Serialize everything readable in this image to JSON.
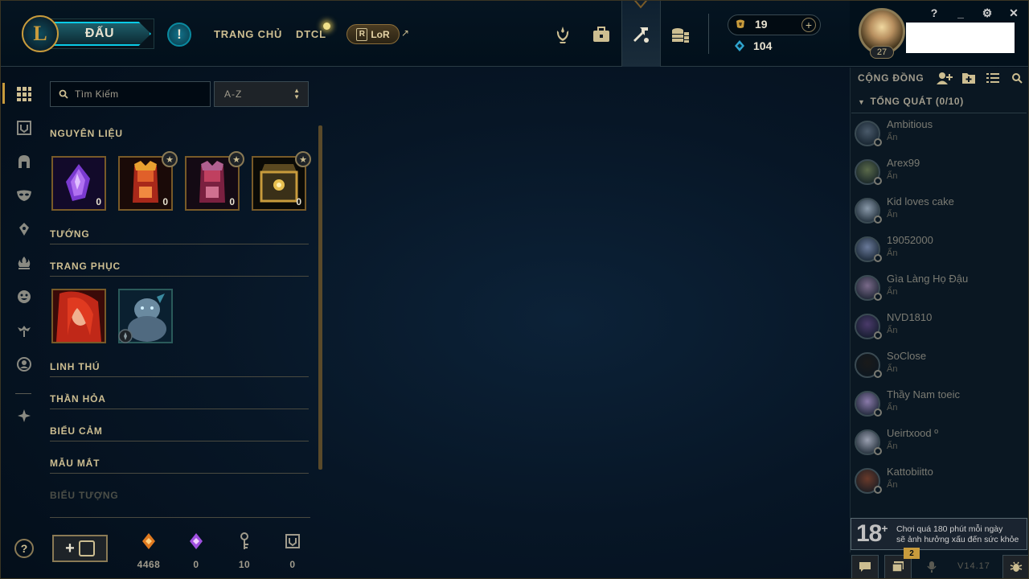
{
  "topbar": {
    "play_label": "ĐẤU",
    "nav_home": "TRANG CHỦ",
    "nav_tft": "DTCL",
    "nav_lor": "LoR",
    "nav_lor_mark": "R",
    "ext_arrow": "↗",
    "alert_glyph": "!"
  },
  "currency": {
    "rp": "19",
    "be": "104"
  },
  "profile": {
    "level": "27"
  },
  "window_controls": {
    "help": "?",
    "minimize": "_",
    "settings": "⚙",
    "close": "✕"
  },
  "collection": {
    "search_placeholder": "Tìm Kiếm",
    "sort_value": "A-Z",
    "sections": {
      "materials": "NGUYÊN LIỆU",
      "champions": "TƯỚNG",
      "skins": "TRANG PHỤC",
      "pets": "LINH THÚ",
      "totems": "THẦN HỎA",
      "emotes": "BIỂU CẢM",
      "ward_skins": "MẪU MẮT",
      "icons": "BIỂU TƯỢNG"
    },
    "materials": [
      {
        "name": "mythic-essence",
        "count": "0",
        "star": false
      },
      {
        "name": "red-chest",
        "count": "0",
        "star": true
      },
      {
        "name": "purple-chest",
        "count": "0",
        "star": true
      },
      {
        "name": "hextech-chest",
        "count": "0",
        "star": true
      }
    ],
    "star_glyph": "★"
  },
  "resources": [
    {
      "name": "orange-essence",
      "value": "4468"
    },
    {
      "name": "mythic-essence",
      "value": "0"
    },
    {
      "name": "key",
      "value": "10"
    },
    {
      "name": "chest",
      "value": "0"
    }
  ],
  "craft_button": {
    "plus": "+"
  },
  "help_button": "?",
  "social": {
    "header": "CỘNG ĐỒNG",
    "group": "TỔNG QUÁT (0/10)",
    "friends": [
      {
        "name": "Ambitious",
        "status": "Ẩn",
        "color": "#4a5a6a"
      },
      {
        "name": "Arex99",
        "status": "Ẩn",
        "color": "#5a6a4a"
      },
      {
        "name": "Kid loves cake",
        "status": "Ẩn",
        "color": "#8a9aaa"
      },
      {
        "name": "19052000",
        "status": "Ẩn",
        "color": "#6a7a9a"
      },
      {
        "name": "Gìa Làng Họ Đậu",
        "status": "Ẩn",
        "color": "#7a6a8a"
      },
      {
        "name": "NVD1810",
        "status": "Ẩn",
        "color": "#4a3a6a"
      },
      {
        "name": "SoClose",
        "status": "Ẩn",
        "color": "#1a1a1a"
      },
      {
        "name": "Thầy Nam toeic",
        "status": "Ẩn",
        "color": "#8a7aaa"
      },
      {
        "name": "Ueirtxood º",
        "status": "Ẩn",
        "color": "#9aa0b0"
      },
      {
        "name": "Kattobiitto",
        "status": "Ẩn",
        "color": "#6a3a2a"
      }
    ],
    "age_rating": "18",
    "age_plus": "+",
    "age_notice_line1": "Chơi quá 180 phút mỗi ngày",
    "age_notice_line2": "sẽ ảnh hưởng xấu đến sức khỏe",
    "notification_count": "2",
    "version": "V14.17"
  }
}
